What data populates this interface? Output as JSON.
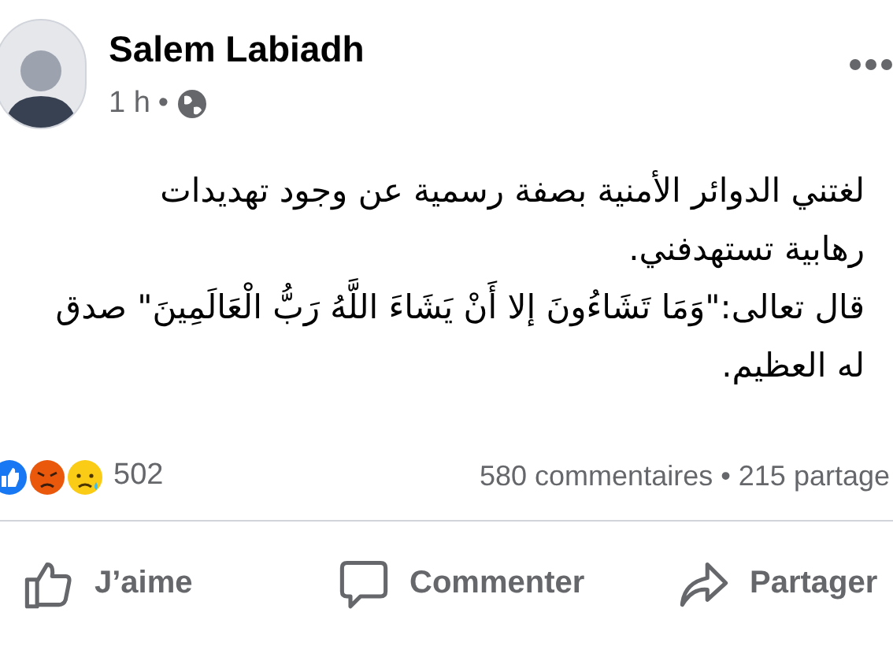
{
  "post": {
    "author": "Salem Labiadh",
    "time": "1 h",
    "time_separator": "•",
    "body_lines": [
      "لغتني الدوائر الأمنية بصفة رسمية عن وجود تهديدات",
      "رهابية تستهدفني.",
      "قال تعالى:\"وَمَا تَشَاءُونَ إلا أَنْ يَشَاءَ اللَّهُ رَبُّ الْعَالَمِينَ\" صدق",
      "له العظيم."
    ],
    "reaction_count": "502",
    "comments": "580 commentaires",
    "stats_separator": "•",
    "shares": "215 partage",
    "like_button": "J’aime",
    "comment_button": "Commenter",
    "share_button": "Partager"
  }
}
